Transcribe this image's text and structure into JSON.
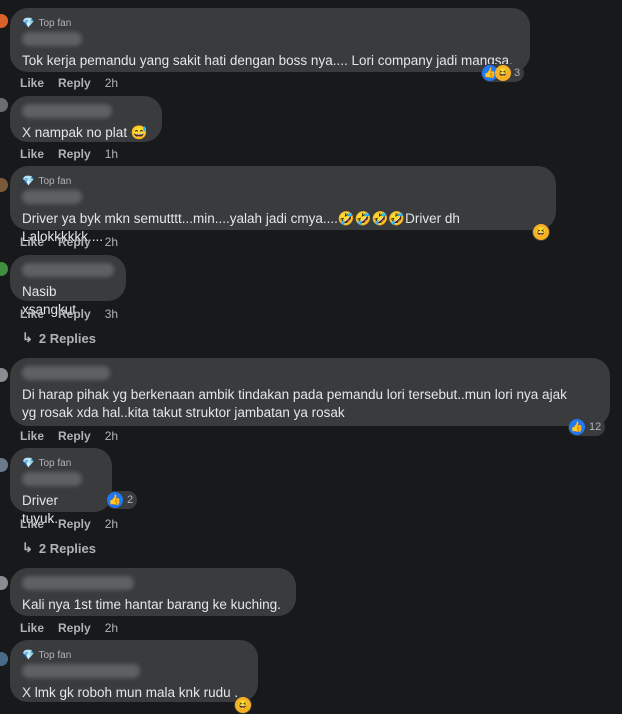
{
  "labels": {
    "like": "Like",
    "reply": "Reply",
    "top_fan": "Top fan"
  },
  "comments": [
    {
      "text": "Tok kerja pemandu yang sakit hati dengan boss nya.... Lori company jadi mangsa.",
      "time": "2h",
      "reactions": "3"
    },
    {
      "text": "X nampak no plat 😅",
      "time": "1h"
    },
    {
      "text": "Driver ya byk mkn semutttt...min....yalah jadi cmya....🤣🤣🤣🤣Driver dh Lalokkkkkk....",
      "time": "2h"
    },
    {
      "text": "Nasib xsangkut",
      "time": "3h",
      "replies": "2 Replies"
    },
    {
      "text": "Di harap pihak yg berkenaan ambik tindakan pada pemandu lori tersebut..mun lori nya ajak",
      "text2": "yg rosak xda hal..kita takut struktor jambatan ya rosak",
      "time": "2h",
      "reactions": "12"
    },
    {
      "text": "Driver tuyuk..",
      "time": "2h",
      "reactions": "2",
      "replies": "2 Replies"
    },
    {
      "text": "Kali nya 1st time hantar barang ke kuching.",
      "time": "2h"
    },
    {
      "text": "X lmk gk roboh mun mala knk rudu .",
      "time": ""
    }
  ],
  "colors": {
    "bg": "#18191a",
    "bubble": "#3a3b3c",
    "like": "#2078f4",
    "haha": "#f7b125"
  }
}
